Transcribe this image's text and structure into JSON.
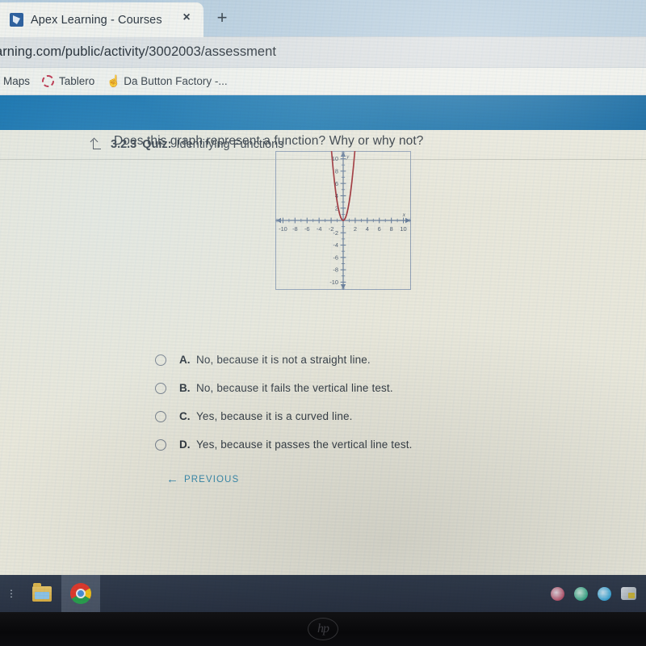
{
  "browser": {
    "tab": {
      "title": "Apex Learning - Courses",
      "favicon_name": "apex-favicon",
      "close_label": "×",
      "new_tab_label": "+"
    },
    "url": "arning.com/public/activity/3002003/assessment",
    "bookmarks": [
      {
        "label": "Maps",
        "icon": ""
      },
      {
        "label": "Tablero",
        "icon": "dashed-circle-icon"
      },
      {
        "label": "Da Button Factory -...",
        "icon": "pointing-hand-icon"
      }
    ]
  },
  "page": {
    "navbar_color": "#1270ac",
    "quiz": {
      "back_icon": "back-arrow-icon",
      "number": "3.2.3",
      "type_label": "Quiz:",
      "title": "Identifying Functions"
    },
    "question": "Does this graph represent a function? Why or why not?",
    "choices": [
      {
        "letter": "A.",
        "text": "No, because it is not a straight line.",
        "selected": false
      },
      {
        "letter": "B.",
        "text": "No, because it fails the vertical line test.",
        "selected": false
      },
      {
        "letter": "C.",
        "text": "Yes, because it is a curved line.",
        "selected": false
      },
      {
        "letter": "D.",
        "text": "Yes, because it passes the vertical line test.",
        "selected": false
      }
    ],
    "previous_button": {
      "arrow": "←",
      "label": "PREVIOUS",
      "color": "#3d8fb0"
    }
  },
  "chart_data": {
    "type": "line",
    "title": "",
    "xlabel": "x",
    "ylabel": "y",
    "xlim": [
      -11,
      11
    ],
    "ylim": [
      -11,
      11
    ],
    "xticks": [
      -10,
      -8,
      -6,
      -4,
      -2,
      2,
      4,
      6,
      8,
      10
    ],
    "yticks": [
      10,
      8,
      6,
      4,
      2,
      -2,
      -4,
      -6,
      -8,
      -10
    ],
    "grid": false,
    "axis_color": "#6a7f9c",
    "curve_color": "#a3343a",
    "series": [
      {
        "name": "parabola",
        "equation": "y = 3x^2",
        "vertex": [
          0,
          0
        ],
        "x": [
          -1.95,
          -1.7,
          -1.45,
          -1.2,
          -1.0,
          -0.8,
          -0.6,
          -0.4,
          -0.2,
          0,
          0.2,
          0.4,
          0.6,
          0.8,
          1.0,
          1.2,
          1.45,
          1.7,
          1.95
        ],
        "y": [
          11.4,
          8.67,
          6.31,
          4.32,
          3.0,
          1.92,
          1.08,
          0.48,
          0.12,
          0,
          0.12,
          0.48,
          1.08,
          1.92,
          3.0,
          4.32,
          6.31,
          8.67,
          11.4
        ]
      }
    ]
  },
  "taskbar": {
    "start_label": "⋮",
    "items": [
      {
        "name": "file-explorer",
        "icon": "folder-icon"
      },
      {
        "name": "google-chrome",
        "icon": "chrome-icon"
      }
    ],
    "tray": [
      {
        "name": "tray-icon-1"
      },
      {
        "name": "tray-icon-2"
      },
      {
        "name": "tray-icon-3"
      },
      {
        "name": "tray-icon-4"
      }
    ]
  },
  "device": {
    "brand_logo": "hp"
  }
}
